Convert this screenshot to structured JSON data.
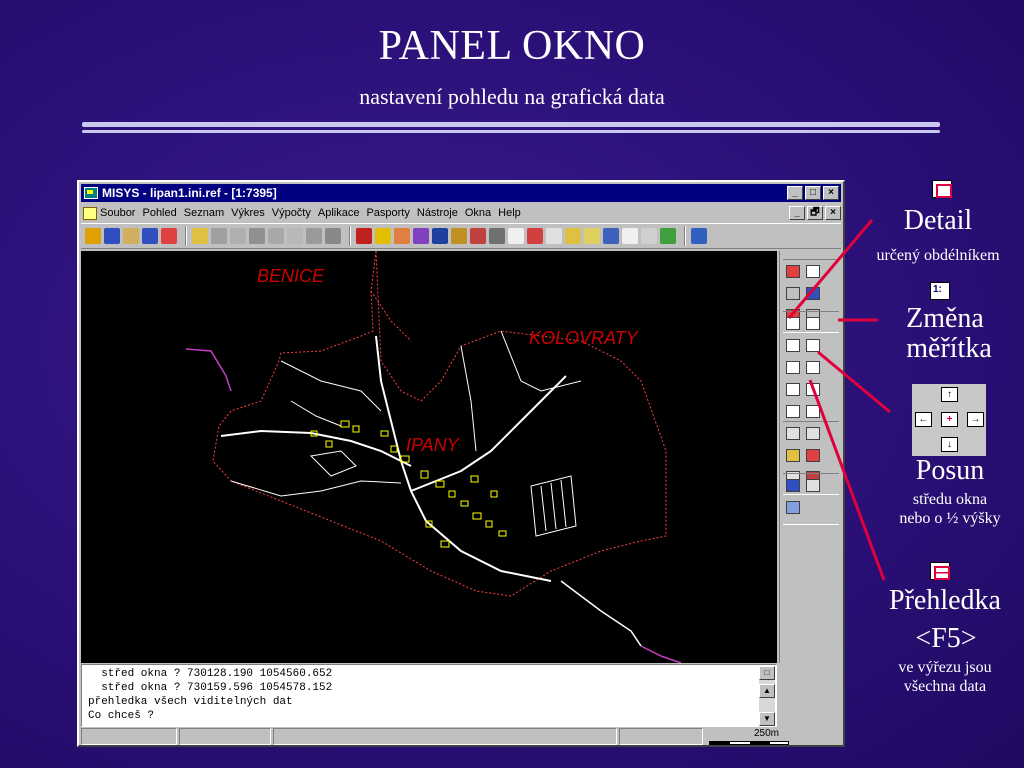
{
  "slide": {
    "title": "PANEL OKNO",
    "subtitle": "nastavení pohledu na grafická data"
  },
  "window": {
    "title": "MISYS - lipan1.ini.ref - [1:7395]",
    "controls": [
      "_",
      "□",
      "×"
    ],
    "mdi_controls": [
      "_",
      "🗗",
      "×"
    ]
  },
  "menu": [
    "Soubor",
    "Pohled",
    "Seznam",
    "Výkres",
    "Výpočty",
    "Aplikace",
    "Pasporty",
    "Nástroje",
    "Okna",
    "Help"
  ],
  "map": {
    "labels": {
      "benice": "BENICE",
      "kolovraty": "KOLOVRATY",
      "lipany": "IPANY"
    }
  },
  "console": {
    "lines": [
      "  střed okna ? 730128.190 1054560.652",
      "  střed okna ? 730159.596 1054578.152",
      "přehledka všech viditelných dat",
      "Co chceš ?"
    ]
  },
  "status": {
    "scale_label": "250m"
  },
  "annotations": {
    "detail": {
      "title": "Detail",
      "desc": "určený obdélníkem"
    },
    "scale": {
      "title_line1": "Změna",
      "title_line2": "měřítka"
    },
    "pan": {
      "title": "Posun",
      "desc_line1": "středu okna",
      "desc_line2": "nebo o ½ výšky"
    },
    "overview": {
      "title": "Přehledka",
      "key": "<F5>",
      "desc_line1": "ve výřezu jsou",
      "desc_line2": "všechna data"
    }
  },
  "colors": {
    "background": "#2b1078",
    "accent_red": "#e0003c",
    "title_bar": "#000080",
    "map_label": "#cc0000"
  }
}
